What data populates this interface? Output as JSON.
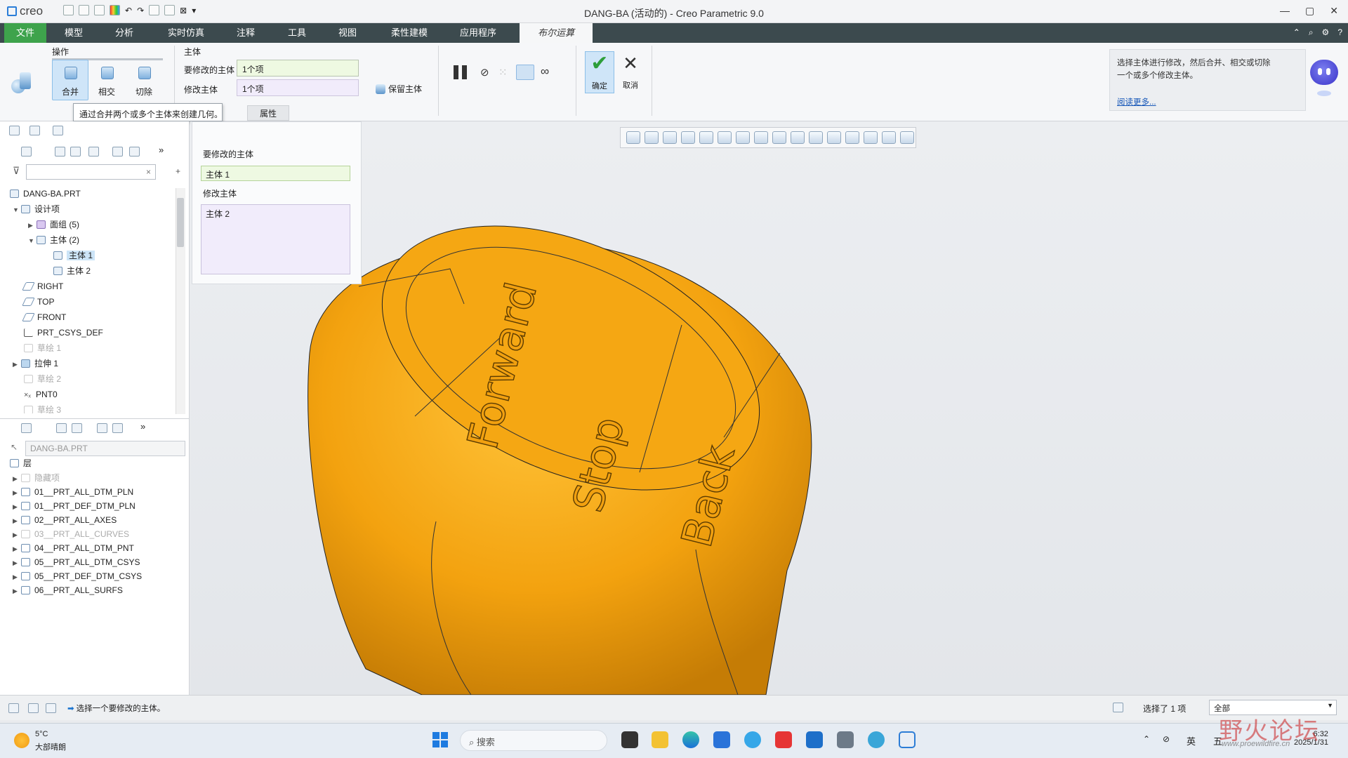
{
  "titlebar": {
    "logo": "creo",
    "title": "DANG-BA (活动的) - Creo Parametric 9.0"
  },
  "menu": {
    "file": "文件",
    "tabs": [
      "模型",
      "分析",
      "实时仿真",
      "注释",
      "工具",
      "视图",
      "柔性建模",
      "应用程序"
    ],
    "active": "布尔运算"
  },
  "ribbon": {
    "ops_group": "操作",
    "merge": "合并",
    "intersect": "相交",
    "cut": "切除",
    "body_group": "主体",
    "body_to_modify_label": "要修改的主体",
    "body_to_modify_value": "1个项",
    "modifying_body_label": "修改主体",
    "modifying_body_value": "1个项",
    "keep_body": "保留主体",
    "ok": "确定",
    "cancel": "取消",
    "properties": "属性",
    "tooltip": "通过合并两个或多个主体来创建几何。",
    "help_text": "选择主体进行修改，然后合并、相交或切除一个或多个修改主体。",
    "help_link": "阅读更多..."
  },
  "model_tree": {
    "root": "DANG-BA.PRT",
    "design_items": "设计项",
    "quilts": "面组 (5)",
    "bodies": "主体 (2)",
    "body1": "主体 1",
    "body2": "主体 2",
    "right": "RIGHT",
    "top": "TOP",
    "front": "FRONT",
    "csys": "PRT_CSYS_DEF",
    "sketch1": "草绘 1",
    "extrude1": "拉伸 1",
    "sketch2": "草绘 2",
    "pnt0": "PNT0",
    "sketch3": "草绘 3"
  },
  "layers": {
    "select": "DANG-BA.PRT",
    "title": "层",
    "hidden": "隐藏项",
    "items": [
      "01__PRT_ALL_DTM_PLN",
      "01__PRT_DEF_DTM_PLN",
      "02__PRT_ALL_AXES",
      "03__PRT_ALL_CURVES",
      "04__PRT_ALL_DTM_PNT",
      "05__PRT_ALL_DTM_CSYS",
      "05__PRT_DEF_DTM_CSYS",
      "06__PRT_ALL_SURFS"
    ]
  },
  "dashboard": {
    "label1": "要修改的主体",
    "value1": "主体 1",
    "label2": "修改主体",
    "value2": "主体 2"
  },
  "model": {
    "text_forward": "Forward",
    "text_stop": "Stop",
    "text_back": "Back",
    "color": "#f0a00f"
  },
  "status": {
    "message": "选择一个要修改的主体。",
    "selected": "选择了 1 项",
    "filter": "全部"
  },
  "taskbar": {
    "temp": "5°C",
    "weather": "大部晴朗",
    "search": "搜索",
    "lang": "英",
    "ime": "五",
    "time": "6:32",
    "date": "2025/1/31"
  },
  "watermark": {
    "text": "野火论坛",
    "url": "www.proewildfire.cn"
  }
}
